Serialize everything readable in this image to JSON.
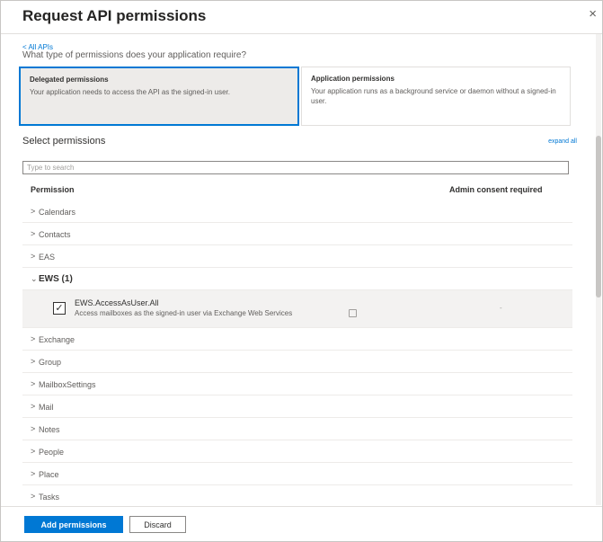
{
  "dialog": {
    "title": "Request API permissions",
    "close_icon": "×"
  },
  "nav": {
    "back_link": "< All APIs",
    "question": "What type of permissions does your application require?"
  },
  "permission_types": [
    {
      "title": "Delegated permissions",
      "description": "Your application needs to access the API as the signed-in user.",
      "selected": true
    },
    {
      "title": "Application permissions",
      "description": "Your application runs as a background service or daemon without a signed-in user.",
      "selected": false
    }
  ],
  "select": {
    "label": "Select permissions",
    "expand_link": "expand all",
    "search_placeholder": "Type to search"
  },
  "table": {
    "col_permission": "Permission",
    "col_admin": "Admin consent required"
  },
  "groups_before": [
    {
      "label": "Calendars",
      "chevron": ">"
    },
    {
      "label": "Contacts",
      "chevron": ">"
    },
    {
      "label": "EAS",
      "chevron": ">"
    }
  ],
  "open_group": {
    "label": "EWS (1)",
    "chevron": "⌄"
  },
  "permission": {
    "name": "EWS.AccessAsUser.All",
    "description": "Access mailboxes as the signed-in user via Exchange Web Services",
    "checked": true,
    "check_mark": "✓",
    "admin_consent": "-"
  },
  "groups_after": [
    {
      "label": "Exchange",
      "chevron": ">"
    },
    {
      "label": "Group",
      "chevron": ">"
    },
    {
      "label": "MailboxSettings",
      "chevron": ">"
    },
    {
      "label": "Mail",
      "chevron": ">"
    },
    {
      "label": "Notes",
      "chevron": ">"
    },
    {
      "label": "People",
      "chevron": ">"
    },
    {
      "label": "Place",
      "chevron": ">"
    },
    {
      "label": "Tasks",
      "chevron": ">"
    }
  ],
  "footer": {
    "add_label": "Add permissions",
    "discard_label": "Discard"
  },
  "colors": {
    "accent": "#0078d4",
    "selected_bg": "#edebe9"
  }
}
